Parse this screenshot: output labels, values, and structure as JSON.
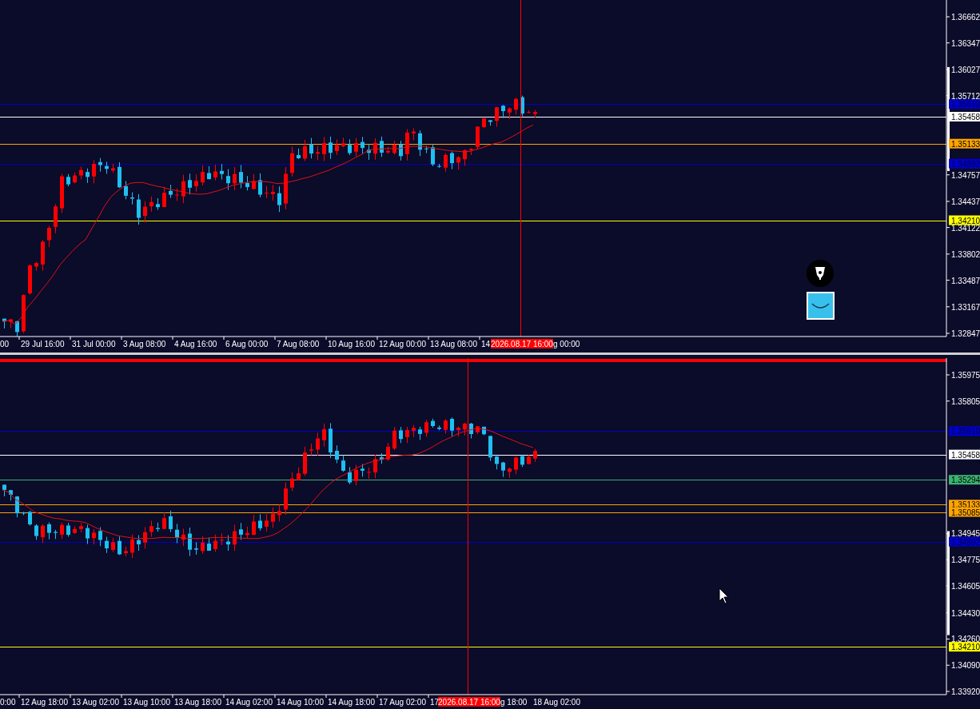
{
  "panels": [
    {
      "price_ticks": [
        "1.36662",
        "1.36347",
        "1.36027",
        "1.35712",
        "1.34757",
        "1.34437",
        "1.34122",
        "1.33802",
        "1.33487",
        "1.33167",
        "1.32847"
      ],
      "price_tags": [
        {
          "text": "1.35610",
          "color": "#0000c8"
        },
        {
          "text": "1.35458",
          "color": "#ffffff"
        },
        {
          "text": "1.35133",
          "color": "#ffa500"
        },
        {
          "text": "1.34892",
          "color": "#0000c8"
        },
        {
          "text": "1.34210",
          "color": "#ffff00"
        }
      ],
      "time_axis": {
        "labels_before": [
          "00",
          "29 Jul 16:00",
          "31 Jul 00:00",
          "3 Aug 08:00",
          "4 Aug 16:00",
          "6 Aug 00:00",
          "7 Aug 08:00",
          "10 Aug 16:00",
          "12 Aug 00:00",
          "13 Aug 08:00",
          "14"
        ],
        "crosshair_label": "2026.08.17 16:00",
        "labels_after": [
          "g 00:00"
        ]
      }
    },
    {
      "price_ticks": [
        "1.35975",
        "1.35805",
        "1.34945",
        "1.34775",
        "1.34605",
        "1.34430",
        "1.34260",
        "1.34090",
        "1.33920"
      ],
      "price_tags": [
        {
          "text": "1.35610",
          "color": "#0000c8"
        },
        {
          "text": "1.35458",
          "color": "#ffffff"
        },
        {
          "text": "1.35294",
          "color": "#3cb371"
        },
        {
          "text": "1.35133",
          "color": "#ffa500"
        },
        {
          "text": "1.35085",
          "color": "#ffa500"
        },
        {
          "text": "1.34892",
          "color": "#0000c8"
        },
        {
          "text": "1.34210",
          "color": "#ffff00"
        }
      ],
      "time_axis": {
        "labels_before": [
          "0:00",
          "12 Aug 18:00",
          "13 Aug 02:00",
          "13 Aug 10:00",
          "13 Aug 18:00",
          "14 Aug 02:00",
          "14 Aug 10:00",
          "14 Aug 18:00",
          "17 Aug 02:00",
          "17"
        ],
        "crosshair_label": "2026.08.17 16:00",
        "labels_after": [
          "g 18:00",
          "18 Aug 02:00"
        ]
      }
    }
  ]
}
